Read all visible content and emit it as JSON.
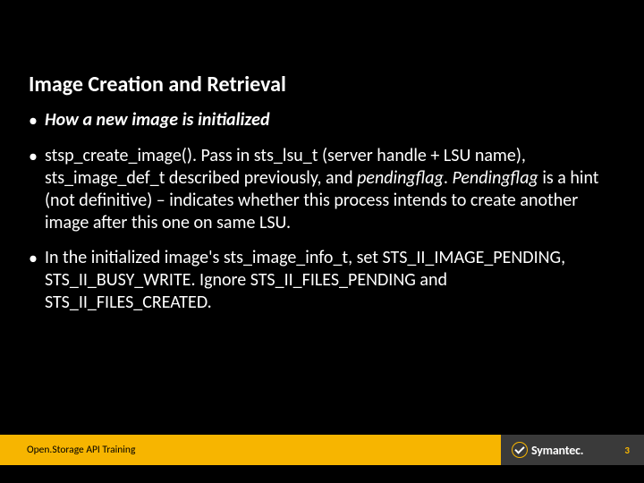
{
  "slide": {
    "title": "Image Creation and Retrieval",
    "bullets": {
      "b1": "How a new image is initialized",
      "b2_pre": "stsp_create_image(). Pass in sts_lsu_t (server handle + LSU name), sts_image_def_t described previously, and ",
      "b2_pf": "pendingflag",
      "b2_mid": ". ",
      "b2_pf2": "Pendingflag",
      "b2_post": " is a hint (not definitive) – indicates whether this process intends to create another image after this one on same LSU.",
      "b3": "In the initialized image's sts_image_info_t, set STS_II_IMAGE_PENDING, STS_II_BUSY_WRITE. Ignore STS_II_FILES_PENDING and STS_II_FILES_CREATED."
    }
  },
  "footer": {
    "left_text": "Open.Storage API Training",
    "brand": "Symantec.",
    "page": "3"
  }
}
